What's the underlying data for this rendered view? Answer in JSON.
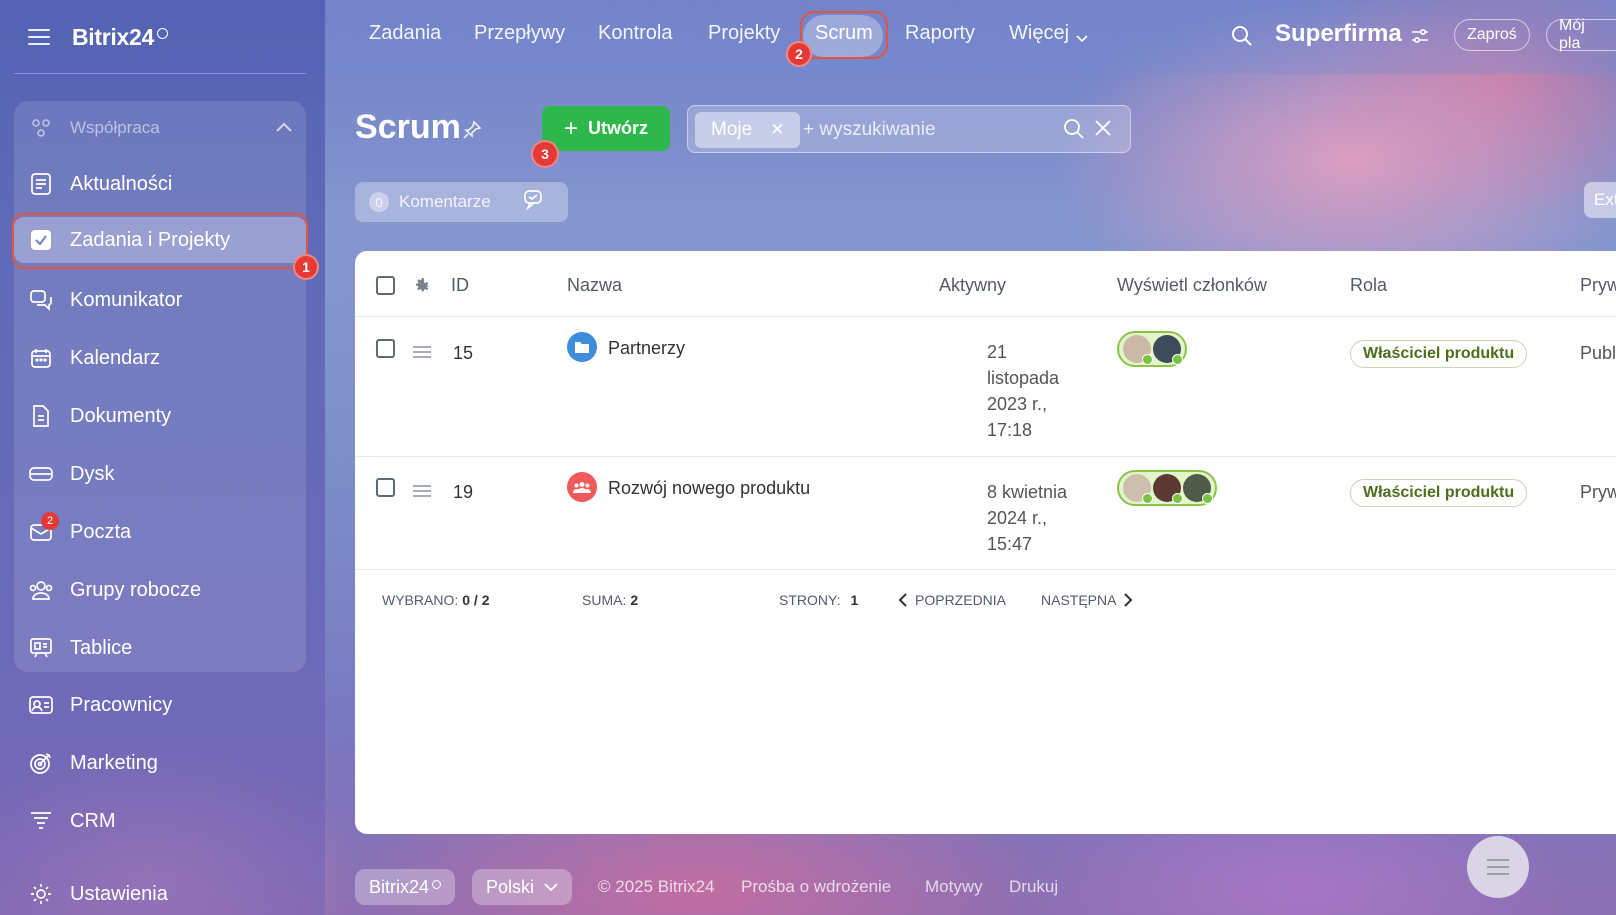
{
  "app": {
    "logo": "Bitrix24"
  },
  "sidebar": {
    "group_label": "Współpraca",
    "items": [
      {
        "label": "Aktualności",
        "icon": "news-icon"
      },
      {
        "label": "Zadania i Projekty",
        "icon": "checkbox-icon",
        "active": true,
        "callout": "1"
      },
      {
        "label": "Komunikator",
        "icon": "chat-icon"
      },
      {
        "label": "Kalendarz",
        "icon": "calendar-icon"
      },
      {
        "label": "Dokumenty",
        "icon": "document-icon"
      },
      {
        "label": "Dysk",
        "icon": "drive-icon"
      },
      {
        "label": "Poczta",
        "icon": "mail-icon",
        "badge": "2"
      },
      {
        "label": "Grupy robocze",
        "icon": "group-icon"
      },
      {
        "label": "Tablice",
        "icon": "board-icon"
      },
      {
        "label": "Pracownicy",
        "icon": "employees-icon"
      },
      {
        "label": "Marketing",
        "icon": "target-icon"
      },
      {
        "label": "CRM",
        "icon": "crm-icon"
      },
      {
        "label": "Ustawienia",
        "icon": "gear-icon"
      }
    ]
  },
  "topnav": {
    "items": [
      "Zadania",
      "Przepływy",
      "Kontrola",
      "Projekty",
      "Scrum",
      "Raporty",
      "Więcej"
    ],
    "active": "Scrum",
    "scrum_callout": "2",
    "company": "Superfirma",
    "invite": "Zaproś",
    "plan": "Mój pla"
  },
  "page": {
    "title": "Scrum",
    "create_label": "Utwórz",
    "create_callout": "3",
    "filter_chip": "Moje",
    "search_placeholder": "+ wyszukiwanie",
    "comments_count": "0",
    "comments_label": "Komentarze",
    "ext_label": "Ext"
  },
  "grid": {
    "headers": {
      "id": "ID",
      "name": "Nazwa",
      "active": "Aktywny",
      "members": "Wyświetl członków",
      "role": "Rola",
      "privacy": "Pryw"
    },
    "rows": [
      {
        "id": "15",
        "name": "Partnerzy",
        "date": [
          "21",
          "listopada",
          "2023 r.,",
          "17:18"
        ],
        "role": "Właściciel produktu",
        "privacy": "Publ"
      },
      {
        "id": "19",
        "name": "Rozwój nowego produktu",
        "date": [
          "8 kwietnia",
          "2024 r.,",
          "15:47"
        ],
        "role": "Właściciel produktu",
        "privacy": "Pryw"
      }
    ],
    "footer": {
      "selected_label": "WYBRANO:",
      "selected_value": "0 / 2",
      "total_label": "SUMA:",
      "total_value": "2",
      "pages_label": "STRONY:",
      "pages_value": "1",
      "prev": "POPRZEDNIA",
      "next": "NASTĘPNA"
    }
  },
  "bottom": {
    "logo": "Bitrix24",
    "language": "Polski",
    "copyright": "© 2025 Bitrix24",
    "links": [
      "Prośba o wdrożenie",
      "Motywy",
      "Drukuj"
    ]
  },
  "colors": {
    "accent_green": "#2eb84b",
    "callout_red": "#e53935",
    "highlight_border": "#e5533d"
  }
}
